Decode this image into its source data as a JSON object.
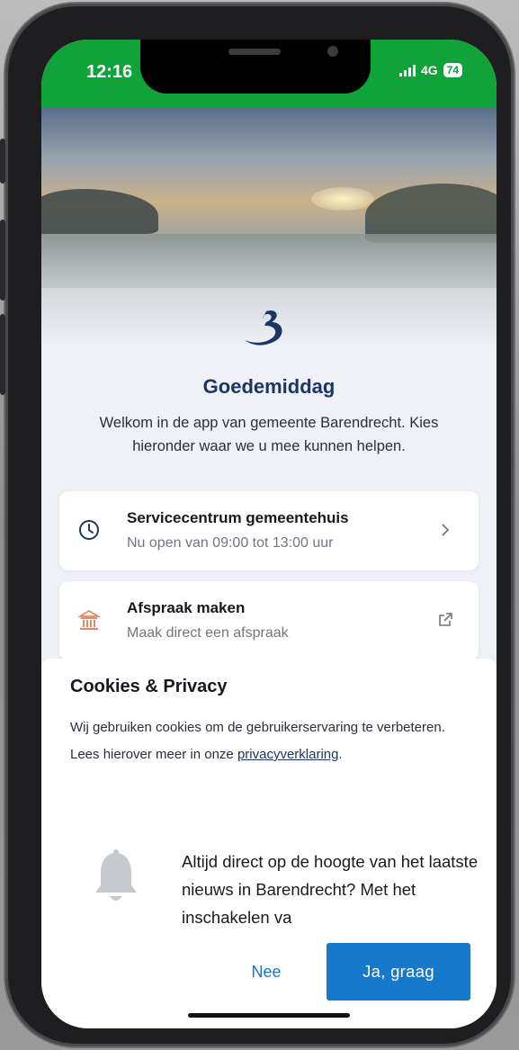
{
  "status_bar": {
    "time": "12:16",
    "signal": "4G",
    "battery": "74",
    "background_color": "#0fa33a"
  },
  "hero": {
    "logo_icon": "barendrecht-b-logo",
    "greeting": "Goedemiddag",
    "welcome_text": "Welkom in de app van gemeente Barendrecht. Kies hieronder waar we u mee kunnen helpen."
  },
  "cards": [
    {
      "icon": "clock-icon",
      "title": "Servicecentrum gemeentehuis",
      "subtitle": "Nu open van 09:00 tot 13:00 uur",
      "action_icon": "chevron-right-icon"
    },
    {
      "icon": "town-hall-icon",
      "title": "Afspraak maken",
      "subtitle": "Maak direct een afspraak",
      "action_icon": "external-link-icon"
    }
  ],
  "cookie": {
    "title": "Cookies & Privacy",
    "text_before": "Wij gebruiken cookies om de gebruikerservaring te verbeteren. Lees hierover meer in onze ",
    "link": "privacyverklaring",
    "text_after": "."
  },
  "notification_prompt": {
    "icon": "bell-icon",
    "text": "Altijd direct op de hoogte van het laatste nieuws in Barendrecht? Met het inschakelen va",
    "decline_label": "Nee",
    "accept_label": "Ja, graag"
  },
  "colors": {
    "brand_blue": "#1c3564",
    "button_blue": "#1779cc",
    "accent_orange": "#e08a6a"
  }
}
